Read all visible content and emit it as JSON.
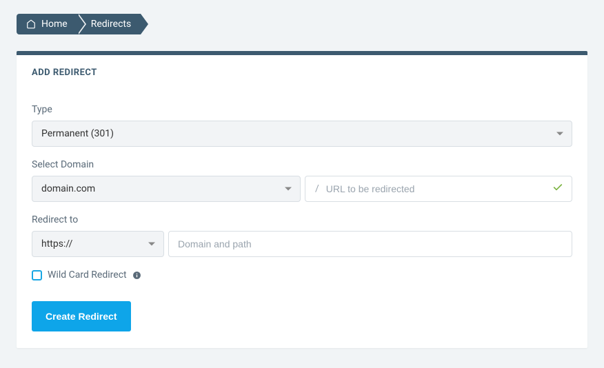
{
  "breadcrumb": {
    "home_label": "Home",
    "redirects_label": "Redirects"
  },
  "card": {
    "title": "ADD REDIRECT"
  },
  "form": {
    "type": {
      "label": "Type",
      "value": "Permanent (301)"
    },
    "domain": {
      "label": "Select Domain",
      "value": "domain.com",
      "path_prefix": "/",
      "path_placeholder": "URL to be redirected"
    },
    "redirect_to": {
      "label": "Redirect to",
      "protocol": "https://",
      "placeholder": "Domain and path"
    },
    "wildcard": {
      "label": "Wild Card Redirect"
    },
    "submit_label": "Create Redirect"
  }
}
